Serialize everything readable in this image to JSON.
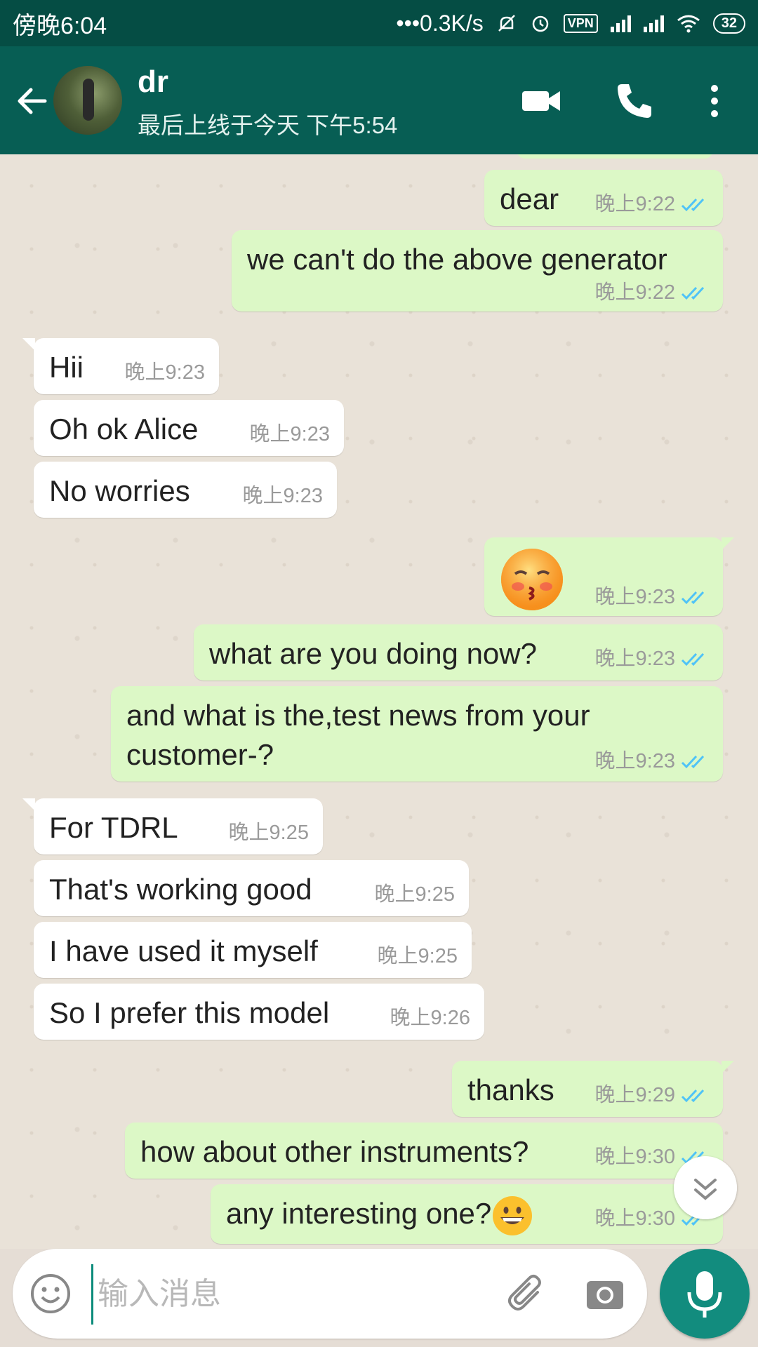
{
  "status_bar": {
    "time": "傍晚6:04",
    "network_speed": "•••0.3K/s",
    "vpn": "VPN",
    "battery": "32"
  },
  "header": {
    "contact_name": "dr",
    "last_seen": "最后上线于今天 下午5:54"
  },
  "messages": [
    {
      "dir": "out",
      "text": "dear",
      "time": "晚上9:22",
      "ticks": "read"
    },
    {
      "dir": "out",
      "text": "we can't do the above generator",
      "time": "晚上9:22",
      "ticks": "read"
    },
    {
      "dir": "in",
      "text": "Hii",
      "time": "晚上9:23"
    },
    {
      "dir": "in",
      "text": "Oh ok Alice",
      "time": "晚上9:23"
    },
    {
      "dir": "in",
      "text": "No worries",
      "time": "晚上9:23"
    },
    {
      "dir": "out",
      "emoji": "kissing-face-with-closed-eyes",
      "time": "晚上9:23",
      "ticks": "read"
    },
    {
      "dir": "out",
      "text": "what are you doing now?",
      "time": "晚上9:23",
      "ticks": "read"
    },
    {
      "dir": "out",
      "text": "and what is the,test news from your customer-?",
      "time": "晚上9:23",
      "ticks": "read"
    },
    {
      "dir": "in",
      "text": "For TDRL",
      "time": "晚上9:25"
    },
    {
      "dir": "in",
      "text": "That's working good",
      "time": "晚上9:25"
    },
    {
      "dir": "in",
      "text": "I have used it myself",
      "time": "晚上9:25"
    },
    {
      "dir": "in",
      "text": "So I prefer this model",
      "time": "晚上9:26"
    },
    {
      "dir": "out",
      "text": "thanks",
      "time": "晚上9:29",
      "ticks": "read"
    },
    {
      "dir": "out",
      "text": "how about other instruments?",
      "time": "晚上9:30",
      "ticks": "read"
    },
    {
      "dir": "out",
      "text": "any interesting one?",
      "emoji": "grinning-face",
      "time": "晚上9:30",
      "ticks": "read"
    }
  ],
  "composer": {
    "placeholder": "输入消息"
  },
  "colors": {
    "header": "#075e54",
    "status_bar": "#054d44",
    "outgoing_bubble": "#dcf8c6",
    "incoming_bubble": "#ffffff",
    "read_ticks": "#4fc3f7",
    "mic_button": "#128c7e"
  },
  "icons": [
    "back-arrow-icon",
    "video-call-icon",
    "phone-icon",
    "more-options-icon",
    "emoji-icon",
    "attach-icon",
    "camera-icon",
    "mic-icon",
    "scroll-down-icon",
    "double-tick-icon"
  ]
}
